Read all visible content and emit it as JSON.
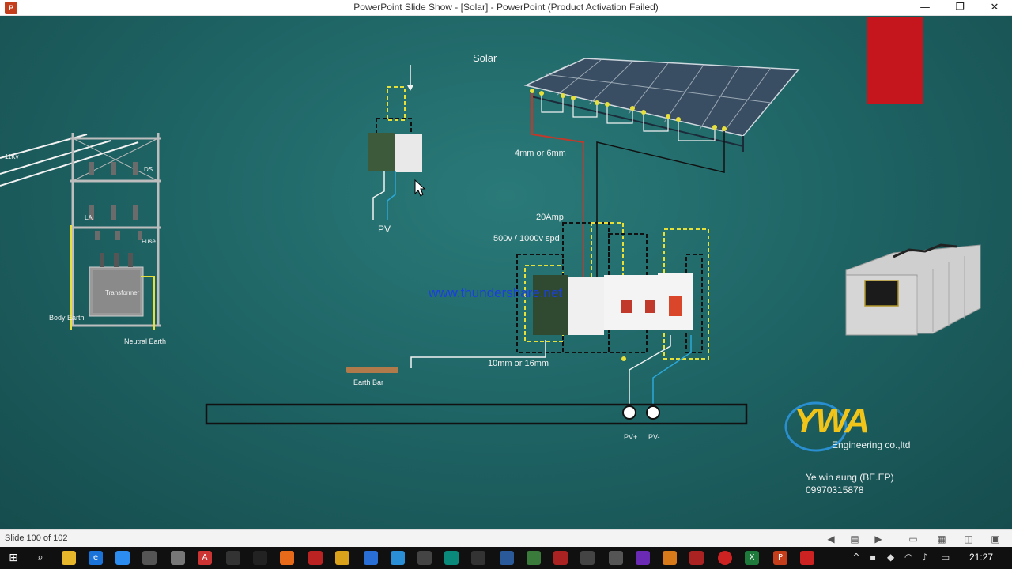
{
  "window": {
    "title": "PowerPoint Slide Show - [Solar] - PowerPoint (Product Activation Failed)",
    "minimize": "—",
    "restore": "❐",
    "close": "✕"
  },
  "slide": {
    "solar_label": "Solar",
    "cable_4mm": "4mm or 6mm",
    "amp_label": "20Amp",
    "spd_label": "500v / 1000v spd",
    "cable_10mm": "10mm or 16mm",
    "pv_label": "PV",
    "earth_bar": "Earth Bar",
    "pv_plus": "PV+",
    "pv_minus": "PV-",
    "website": "www.thundershare.net",
    "kv_label": "11Kv",
    "ds_label": "DS",
    "la_label": "LA",
    "fuse_label": "Fuse",
    "transformer_label": "Transformer",
    "body_earth": "Body Earth",
    "neutral_earth": "Neutral Earth",
    "logo_text": "YWA",
    "company": "Engineering co.,ltd",
    "author": "Ye win aung (BE.EP)",
    "phone": "09970315878"
  },
  "statusbar": {
    "slide_number": "Slide 100 of 102"
  },
  "taskbar": {
    "time": "21:27"
  },
  "colors": {
    "slide_bg": "#1f6566",
    "accent_red": "#c4161c",
    "link_blue": "#1a3fe0",
    "wire_yellow": "#e8e03a",
    "wire_red": "#c0392b",
    "wire_blue": "#2aa8d8"
  }
}
